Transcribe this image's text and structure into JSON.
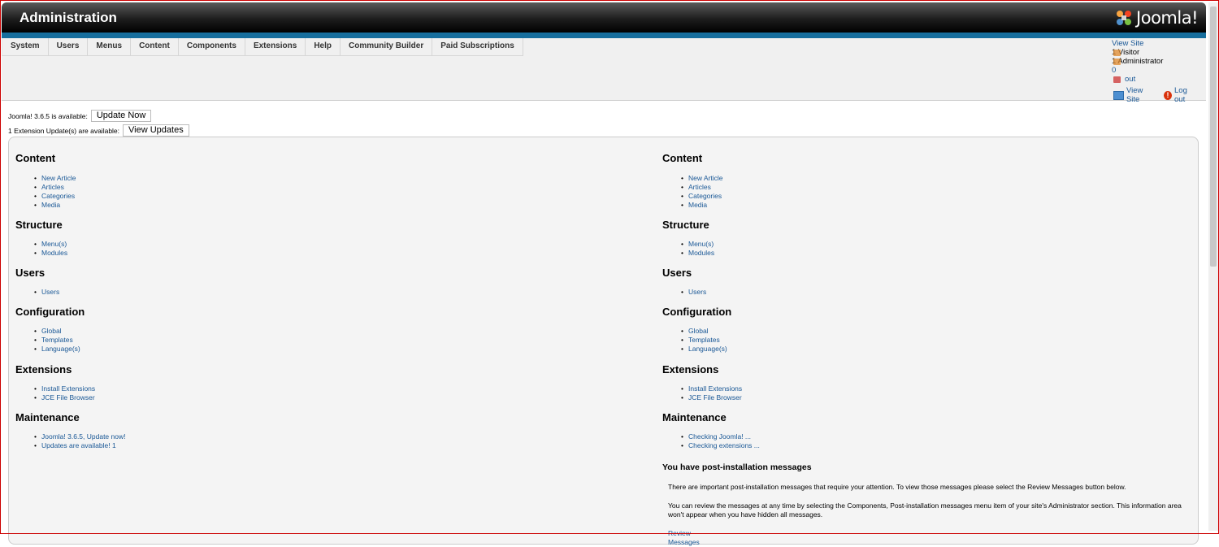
{
  "header": {
    "title": "Administration",
    "logo_text": "Joomla!"
  },
  "menu": [
    "System",
    "Users",
    "Menus",
    "Content",
    "Components",
    "Extensions",
    "Help",
    "Community Builder",
    "Paid Subscriptions"
  ],
  "status": {
    "view_site_top": "View Site",
    "visitor": "1 Visitor",
    "administrator": "1 Administrator",
    "messages": "0",
    "log_out_top": "out",
    "view_site": "View Site",
    "log_out": "Log out"
  },
  "notices": {
    "joomla": {
      "text": "Joomla! 3.6.5 is available:",
      "button": "Update Now"
    },
    "extensions": {
      "text": "1 Extension Update(s) are available:",
      "button": "View Updates"
    }
  },
  "left_column": {
    "content": {
      "title": "Content",
      "items": [
        "New Article",
        "Articles",
        "Categories",
        "Media"
      ]
    },
    "structure": {
      "title": "Structure",
      "items": [
        "Menu(s)",
        "Modules"
      ]
    },
    "users": {
      "title": "Users",
      "items": [
        "Users"
      ]
    },
    "configuration": {
      "title": "Configuration",
      "items": [
        "Global",
        "Templates",
        "Language(s)"
      ]
    },
    "extensions": {
      "title": "Extensions",
      "items": [
        "Install Extensions",
        "JCE File Browser"
      ]
    },
    "maintenance": {
      "title": "Maintenance",
      "items": [
        "Joomla! 3.6.5, Update now!",
        "Updates are available! 1"
      ]
    }
  },
  "right_column": {
    "content": {
      "title": "Content",
      "items": [
        "New Article",
        "Articles",
        "Categories",
        "Media"
      ]
    },
    "structure": {
      "title": "Structure",
      "items": [
        "Menu(s)",
        "Modules"
      ]
    },
    "users": {
      "title": "Users",
      "items": [
        "Users"
      ]
    },
    "configuration": {
      "title": "Configuration",
      "items": [
        "Global",
        "Templates",
        "Language(s)"
      ]
    },
    "extensions": {
      "title": "Extensions",
      "items": [
        "Install Extensions",
        "JCE File Browser"
      ]
    },
    "maintenance": {
      "title": "Maintenance",
      "items": [
        "Checking Joomla! ...",
        "Checking extensions ..."
      ]
    }
  },
  "post_install": {
    "title": "You have post-installation messages",
    "para1": "There are important post-installation messages that require your attention. To view those messages please select the Review Messages button below.",
    "para2": "You can review the messages at any time by selecting the Components, Post-installation messages menu item of your site's Administrator section. This information area won't appear when you have hidden all messages.",
    "link": "Review Messages"
  },
  "colors": {
    "link": "#1a5896",
    "accent_bar": "#166e9d",
    "header": "#1d1d1d"
  }
}
